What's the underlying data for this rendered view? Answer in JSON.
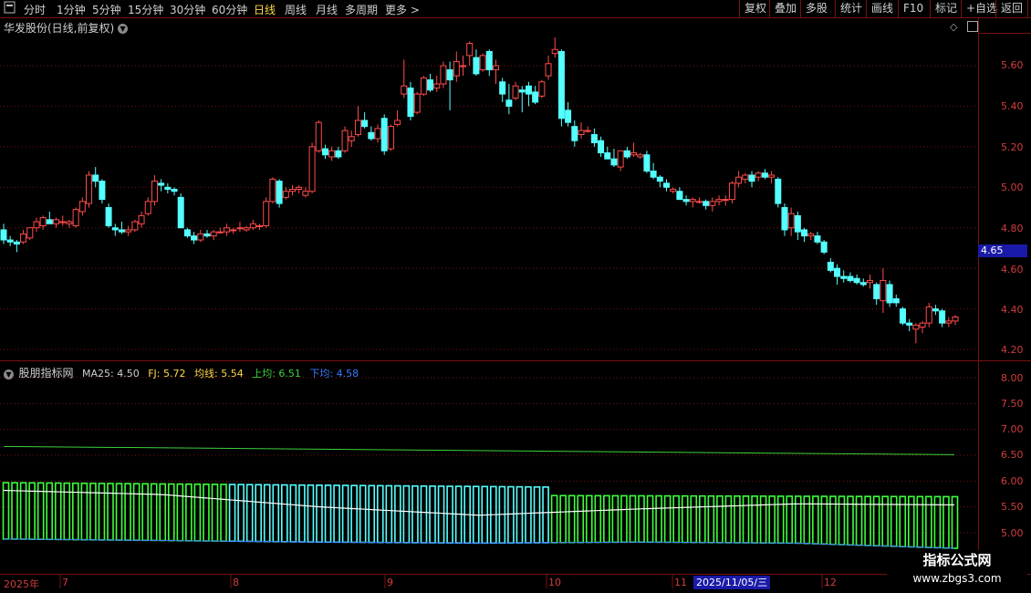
{
  "toolbar": {
    "menu_icon": "menu-icon",
    "periods": [
      "分时",
      "1分钟",
      "5分钟",
      "15分钟",
      "30分钟",
      "60分钟",
      "日线",
      "周线",
      "月线",
      "多周期",
      "更多 >"
    ],
    "active_period": "日线",
    "right_buttons": [
      "复权",
      "叠加",
      "多股",
      "统计",
      "画线",
      "F10",
      "标记",
      "+自选",
      "返回"
    ]
  },
  "main_pane": {
    "title": "华发股份(日线,前复权)",
    "price_axis": [
      "5.60",
      "5.40",
      "5.20",
      "5.00",
      "4.80",
      "4.60",
      "4.40",
      "4.20"
    ],
    "current_price_tag": "4.65"
  },
  "indicator_pane": {
    "name": "股朋指标网",
    "items": [
      {
        "label": "MA25: 4.50",
        "color": "#d0d0d0"
      },
      {
        "label": "FJ: 5.72",
        "color": "#ffd84a"
      },
      {
        "label": "均线: 5.54",
        "color": "#ffd84a"
      },
      {
        "label": "上均: 6.51",
        "color": "#3cd23c"
      },
      {
        "label": "下均: 4.58",
        "color": "#3c78ff"
      }
    ],
    "axis": [
      "8.00",
      "7.50",
      "7.00",
      "6.50",
      "6.00",
      "5.50",
      "5.00"
    ]
  },
  "date_axis": {
    "labels": [
      "2025年",
      "7",
      "8",
      "9",
      "10",
      "11",
      "12"
    ],
    "highlight": "2025/11/05/三"
  },
  "watermark": {
    "title": "指标公式网",
    "url": "www.zbgs3.com"
  },
  "colors": {
    "up": "#ff4b4b",
    "down": "#54ffff",
    "grid": "#7a1010",
    "bar_cyan": "#54ffff",
    "bar_green": "#3cff3c"
  },
  "chart_data": {
    "type": "candlestick",
    "ylim": [
      4.2,
      5.75
    ],
    "candles": [
      {
        "o": 4.79,
        "h": 4.82,
        "l": 4.72,
        "c": 4.74
      },
      {
        "o": 4.74,
        "h": 4.76,
        "l": 4.71,
        "c": 4.73
      },
      {
        "o": 4.73,
        "h": 4.74,
        "l": 4.68,
        "c": 4.72
      },
      {
        "o": 4.73,
        "h": 4.79,
        "l": 4.72,
        "c": 4.77
      },
      {
        "o": 4.75,
        "h": 4.8,
        "l": 4.74,
        "c": 4.8
      },
      {
        "o": 4.8,
        "h": 4.85,
        "l": 4.78,
        "c": 4.83
      },
      {
        "o": 4.81,
        "h": 4.86,
        "l": 4.79,
        "c": 4.85
      },
      {
        "o": 4.84,
        "h": 4.88,
        "l": 4.82,
        "c": 4.82
      },
      {
        "o": 4.82,
        "h": 4.85,
        "l": 4.8,
        "c": 4.84
      },
      {
        "o": 4.83,
        "h": 4.86,
        "l": 4.81,
        "c": 4.83
      },
      {
        "o": 4.82,
        "h": 4.84,
        "l": 4.8,
        "c": 4.83
      },
      {
        "o": 4.81,
        "h": 4.9,
        "l": 4.8,
        "c": 4.89
      },
      {
        "o": 4.88,
        "h": 4.95,
        "l": 4.86,
        "c": 4.93
      },
      {
        "o": 4.92,
        "h": 5.08,
        "l": 4.9,
        "c": 5.06
      },
      {
        "o": 5.06,
        "h": 5.1,
        "l": 5.0,
        "c": 5.03
      },
      {
        "o": 5.03,
        "h": 5.04,
        "l": 4.92,
        "c": 4.94
      },
      {
        "o": 4.9,
        "h": 4.92,
        "l": 4.8,
        "c": 4.81
      },
      {
        "o": 4.8,
        "h": 4.82,
        "l": 4.76,
        "c": 4.79
      },
      {
        "o": 4.79,
        "h": 4.83,
        "l": 4.77,
        "c": 4.78
      },
      {
        "o": 4.78,
        "h": 4.81,
        "l": 4.76,
        "c": 4.79
      },
      {
        "o": 4.79,
        "h": 4.84,
        "l": 4.78,
        "c": 4.83
      },
      {
        "o": 4.82,
        "h": 4.88,
        "l": 4.8,
        "c": 4.86
      },
      {
        "o": 4.87,
        "h": 4.95,
        "l": 4.86,
        "c": 4.93
      },
      {
        "o": 4.93,
        "h": 5.06,
        "l": 4.91,
        "c": 5.03
      },
      {
        "o": 5.02,
        "h": 5.04,
        "l": 4.98,
        "c": 5.01
      },
      {
        "o": 5.0,
        "h": 5.02,
        "l": 4.97,
        "c": 4.99
      },
      {
        "o": 4.99,
        "h": 5.0,
        "l": 4.96,
        "c": 4.98
      },
      {
        "o": 4.95,
        "h": 4.97,
        "l": 4.82,
        "c": 4.8
      },
      {
        "o": 4.79,
        "h": 4.8,
        "l": 4.75,
        "c": 4.76
      },
      {
        "o": 4.76,
        "h": 4.78,
        "l": 4.72,
        "c": 4.74
      },
      {
        "o": 4.74,
        "h": 4.79,
        "l": 4.73,
        "c": 4.77
      },
      {
        "o": 4.77,
        "h": 4.79,
        "l": 4.75,
        "c": 4.76
      },
      {
        "o": 4.76,
        "h": 4.79,
        "l": 4.74,
        "c": 4.78
      },
      {
        "o": 4.78,
        "h": 4.8,
        "l": 4.77,
        "c": 4.78
      },
      {
        "o": 4.78,
        "h": 4.82,
        "l": 4.76,
        "c": 4.8
      },
      {
        "o": 4.79,
        "h": 4.8,
        "l": 4.77,
        "c": 4.79
      },
      {
        "o": 4.8,
        "h": 4.83,
        "l": 4.78,
        "c": 4.8
      },
      {
        "o": 4.79,
        "h": 4.81,
        "l": 4.78,
        "c": 4.8
      },
      {
        "o": 4.8,
        "h": 4.84,
        "l": 4.79,
        "c": 4.82
      },
      {
        "o": 4.81,
        "h": 4.82,
        "l": 4.79,
        "c": 4.81
      },
      {
        "o": 4.81,
        "h": 4.95,
        "l": 4.8,
        "c": 4.93
      },
      {
        "o": 4.93,
        "h": 5.05,
        "l": 4.92,
        "c": 5.04
      },
      {
        "o": 5.03,
        "h": 5.04,
        "l": 4.9,
        "c": 4.92
      },
      {
        "o": 4.95,
        "h": 5.0,
        "l": 4.94,
        "c": 4.98
      },
      {
        "o": 4.98,
        "h": 5.01,
        "l": 4.96,
        "c": 4.99
      },
      {
        "o": 4.99,
        "h": 5.01,
        "l": 4.97,
        "c": 5.0
      },
      {
        "o": 4.96,
        "h": 5.0,
        "l": 4.95,
        "c": 4.98
      },
      {
        "o": 4.98,
        "h": 5.22,
        "l": 4.97,
        "c": 5.2
      },
      {
        "o": 5.18,
        "h": 5.33,
        "l": 5.17,
        "c": 5.32
      },
      {
        "o": 5.19,
        "h": 5.21,
        "l": 5.14,
        "c": 5.16
      },
      {
        "o": 5.15,
        "h": 5.2,
        "l": 5.13,
        "c": 5.18
      },
      {
        "o": 5.18,
        "h": 5.2,
        "l": 5.14,
        "c": 5.15
      },
      {
        "o": 5.18,
        "h": 5.3,
        "l": 5.17,
        "c": 5.28
      },
      {
        "o": 5.23,
        "h": 5.28,
        "l": 5.2,
        "c": 5.25
      },
      {
        "o": 5.26,
        "h": 5.4,
        "l": 5.25,
        "c": 5.33
      },
      {
        "o": 5.33,
        "h": 5.37,
        "l": 5.29,
        "c": 5.3
      },
      {
        "o": 5.27,
        "h": 5.3,
        "l": 5.23,
        "c": 5.24
      },
      {
        "o": 5.24,
        "h": 5.31,
        "l": 5.22,
        "c": 5.29
      },
      {
        "o": 5.34,
        "h": 5.36,
        "l": 5.16,
        "c": 5.18
      },
      {
        "o": 5.19,
        "h": 5.31,
        "l": 5.18,
        "c": 5.3
      },
      {
        "o": 5.31,
        "h": 5.38,
        "l": 5.3,
        "c": 5.33
      },
      {
        "o": 5.46,
        "h": 5.63,
        "l": 5.44,
        "c": 5.5
      },
      {
        "o": 5.49,
        "h": 5.52,
        "l": 5.33,
        "c": 5.35
      },
      {
        "o": 5.37,
        "h": 5.47,
        "l": 5.36,
        "c": 5.46
      },
      {
        "o": 5.46,
        "h": 5.55,
        "l": 5.45,
        "c": 5.54
      },
      {
        "o": 5.53,
        "h": 5.56,
        "l": 5.47,
        "c": 5.48
      },
      {
        "o": 5.49,
        "h": 5.55,
        "l": 5.47,
        "c": 5.51
      },
      {
        "o": 5.51,
        "h": 5.62,
        "l": 5.49,
        "c": 5.6
      },
      {
        "o": 5.58,
        "h": 5.62,
        "l": 5.38,
        "c": 5.53
      },
      {
        "o": 5.55,
        "h": 5.67,
        "l": 5.52,
        "c": 5.62
      },
      {
        "o": 5.6,
        "h": 5.65,
        "l": 5.55,
        "c": 5.6
      },
      {
        "o": 5.65,
        "h": 5.72,
        "l": 5.6,
        "c": 5.71
      },
      {
        "o": 5.64,
        "h": 5.68,
        "l": 5.55,
        "c": 5.56
      },
      {
        "o": 5.58,
        "h": 5.66,
        "l": 5.57,
        "c": 5.65
      },
      {
        "o": 5.67,
        "h": 5.68,
        "l": 5.55,
        "c": 5.58
      },
      {
        "o": 5.58,
        "h": 5.63,
        "l": 5.51,
        "c": 5.6
      },
      {
        "o": 5.52,
        "h": 5.54,
        "l": 5.42,
        "c": 5.46
      },
      {
        "o": 5.43,
        "h": 5.51,
        "l": 5.36,
        "c": 5.4
      },
      {
        "o": 5.44,
        "h": 5.52,
        "l": 5.43,
        "c": 5.5
      },
      {
        "o": 5.48,
        "h": 5.5,
        "l": 5.37,
        "c": 5.47
      },
      {
        "o": 5.5,
        "h": 5.52,
        "l": 5.4,
        "c": 5.46
      },
      {
        "o": 5.47,
        "h": 5.5,
        "l": 5.41,
        "c": 5.42
      },
      {
        "o": 5.45,
        "h": 5.53,
        "l": 5.44,
        "c": 5.52
      },
      {
        "o": 5.55,
        "h": 5.65,
        "l": 5.53,
        "c": 5.61
      },
      {
        "o": 5.66,
        "h": 5.74,
        "l": 5.64,
        "c": 5.68
      },
      {
        "o": 5.67,
        "h": 5.68,
        "l": 5.3,
        "c": 5.34
      },
      {
        "o": 5.38,
        "h": 5.42,
        "l": 5.3,
        "c": 5.32
      },
      {
        "o": 5.3,
        "h": 5.33,
        "l": 5.2,
        "c": 5.23
      },
      {
        "o": 5.26,
        "h": 5.32,
        "l": 5.24,
        "c": 5.28
      },
      {
        "o": 5.28,
        "h": 5.3,
        "l": 5.27,
        "c": 5.28
      },
      {
        "o": 5.26,
        "h": 5.29,
        "l": 5.2,
        "c": 5.22
      },
      {
        "o": 5.23,
        "h": 5.25,
        "l": 5.15,
        "c": 5.17
      },
      {
        "o": 5.17,
        "h": 5.2,
        "l": 5.14,
        "c": 5.14
      },
      {
        "o": 5.14,
        "h": 5.19,
        "l": 5.1,
        "c": 5.11
      },
      {
        "o": 5.1,
        "h": 5.18,
        "l": 5.08,
        "c": 5.18
      },
      {
        "o": 5.18,
        "h": 5.2,
        "l": 5.14,
        "c": 5.15
      },
      {
        "o": 5.16,
        "h": 5.22,
        "l": 5.15,
        "c": 5.17
      },
      {
        "o": 5.15,
        "h": 5.17,
        "l": 5.14,
        "c": 5.16
      },
      {
        "o": 5.16,
        "h": 5.18,
        "l": 5.07,
        "c": 5.08
      },
      {
        "o": 5.08,
        "h": 5.12,
        "l": 5.04,
        "c": 5.05
      },
      {
        "o": 5.05,
        "h": 5.06,
        "l": 5.0,
        "c": 5.03
      },
      {
        "o": 5.02,
        "h": 5.04,
        "l": 4.98,
        "c": 5.0
      },
      {
        "o": 4.98,
        "h": 5.0,
        "l": 4.97,
        "c": 4.99
      },
      {
        "o": 4.98,
        "h": 5.0,
        "l": 4.94,
        "c": 4.94
      },
      {
        "o": 4.94,
        "h": 4.96,
        "l": 4.91,
        "c": 4.93
      },
      {
        "o": 4.93,
        "h": 4.95,
        "l": 4.9,
        "c": 4.94
      },
      {
        "o": 4.93,
        "h": 4.95,
        "l": 4.92,
        "c": 4.93
      },
      {
        "o": 4.93,
        "h": 4.94,
        "l": 4.89,
        "c": 4.91
      },
      {
        "o": 4.91,
        "h": 4.95,
        "l": 4.88,
        "c": 4.93
      },
      {
        "o": 4.93,
        "h": 4.96,
        "l": 4.91,
        "c": 4.94
      },
      {
        "o": 4.94,
        "h": 4.96,
        "l": 4.91,
        "c": 4.94
      },
      {
        "o": 4.94,
        "h": 5.03,
        "l": 4.92,
        "c": 5.02
      },
      {
        "o": 5.02,
        "h": 5.08,
        "l": 5.0,
        "c": 5.05
      },
      {
        "o": 5.04,
        "h": 5.07,
        "l": 5.02,
        "c": 5.06
      },
      {
        "o": 5.06,
        "h": 5.08,
        "l": 5.0,
        "c": 5.03
      },
      {
        "o": 5.05,
        "h": 5.08,
        "l": 5.03,
        "c": 5.07
      },
      {
        "o": 5.07,
        "h": 5.09,
        "l": 5.04,
        "c": 5.05
      },
      {
        "o": 5.05,
        "h": 5.08,
        "l": 5.02,
        "c": 5.06
      },
      {
        "o": 5.04,
        "h": 5.05,
        "l": 4.9,
        "c": 4.92
      },
      {
        "o": 4.9,
        "h": 4.92,
        "l": 4.76,
        "c": 4.79
      },
      {
        "o": 4.8,
        "h": 4.9,
        "l": 4.76,
        "c": 4.87
      },
      {
        "o": 4.86,
        "h": 4.88,
        "l": 4.74,
        "c": 4.78
      },
      {
        "o": 4.79,
        "h": 4.8,
        "l": 4.73,
        "c": 4.76
      },
      {
        "o": 4.76,
        "h": 4.78,
        "l": 4.74,
        "c": 4.77
      },
      {
        "o": 4.76,
        "h": 4.78,
        "l": 4.72,
        "c": 4.73
      },
      {
        "o": 4.73,
        "h": 4.74,
        "l": 4.67,
        "c": 4.68
      },
      {
        "o": 4.63,
        "h": 4.65,
        "l": 4.58,
        "c": 4.59
      },
      {
        "o": 4.6,
        "h": 4.62,
        "l": 4.52,
        "c": 4.56
      },
      {
        "o": 4.56,
        "h": 4.59,
        "l": 4.53,
        "c": 4.55
      },
      {
        "o": 4.56,
        "h": 4.58,
        "l": 4.53,
        "c": 4.54
      },
      {
        "o": 4.55,
        "h": 4.57,
        "l": 4.52,
        "c": 4.53
      },
      {
        "o": 4.53,
        "h": 4.55,
        "l": 4.51,
        "c": 4.52
      },
      {
        "o": 4.53,
        "h": 4.57,
        "l": 4.5,
        "c": 4.54
      },
      {
        "o": 4.52,
        "h": 4.53,
        "l": 4.42,
        "c": 4.45
      },
      {
        "o": 4.44,
        "h": 4.6,
        "l": 4.38,
        "c": 4.54
      },
      {
        "o": 4.52,
        "h": 4.54,
        "l": 4.41,
        "c": 4.43
      },
      {
        "o": 4.45,
        "h": 4.47,
        "l": 4.41,
        "c": 4.43
      },
      {
        "o": 4.4,
        "h": 4.41,
        "l": 4.32,
        "c": 4.33
      },
      {
        "o": 4.33,
        "h": 4.35,
        "l": 4.29,
        "c": 4.32
      },
      {
        "o": 4.3,
        "h": 4.33,
        "l": 4.23,
        "c": 4.32
      },
      {
        "o": 4.31,
        "h": 4.34,
        "l": 4.28,
        "c": 4.33
      },
      {
        "o": 4.33,
        "h": 4.43,
        "l": 4.31,
        "c": 4.41
      },
      {
        "o": 4.4,
        "h": 4.42,
        "l": 4.37,
        "c": 4.39
      },
      {
        "o": 4.39,
        "h": 4.4,
        "l": 4.31,
        "c": 4.33
      },
      {
        "o": 4.33,
        "h": 4.36,
        "l": 4.31,
        "c": 4.34
      },
      {
        "o": 4.34,
        "h": 4.37,
        "l": 4.32,
        "c": 4.36
      }
    ],
    "indicator": {
      "ylim": [
        4.7,
        8.3
      ],
      "upper": [
        6.67,
        6.51
      ],
      "bars_top": 5.97,
      "bars_green_top": 5.72,
      "avg_line": [
        5.82,
        5.74,
        5.5,
        5.34,
        5.46,
        5.56,
        5.54
      ],
      "lower_line": [
        4.88,
        4.85,
        4.82,
        4.8,
        4.82,
        4.8,
        4.7
      ],
      "cyan_split": 0.66
    }
  }
}
